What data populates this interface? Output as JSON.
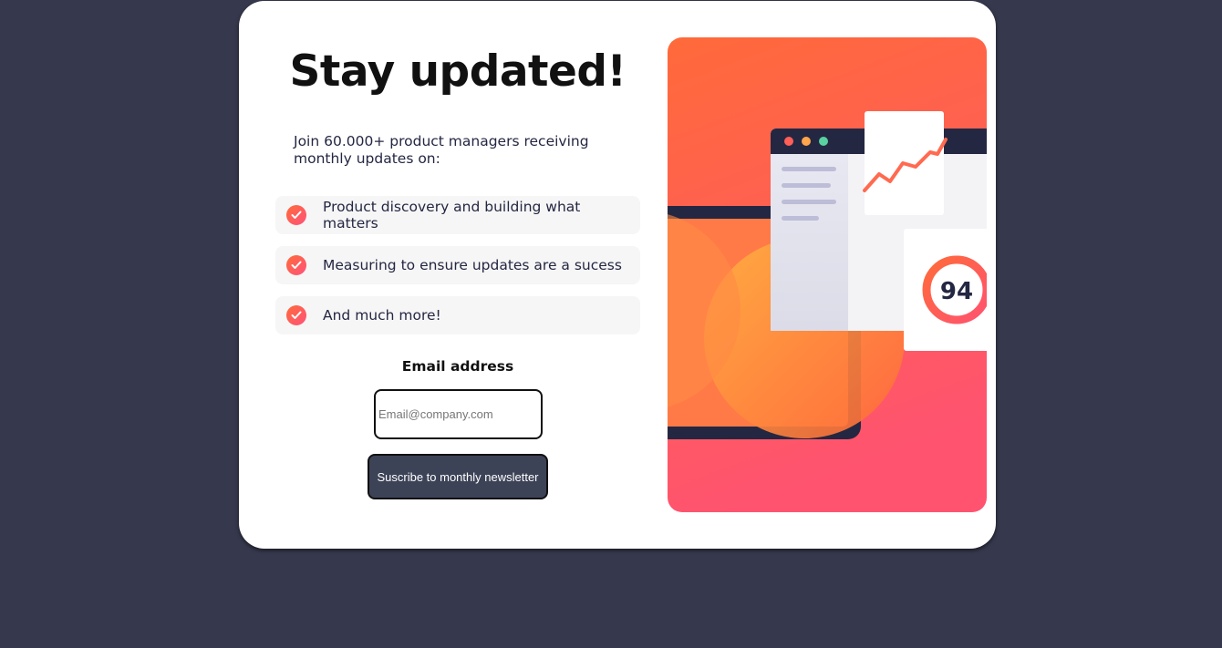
{
  "card": {
    "title": "Stay updated!",
    "intro": "Join 60.000+ product managers receiving monthly updates on:",
    "features": [
      {
        "label": "Product discovery and building what matters",
        "icon": "check-icon"
      },
      {
        "label": "Measuring to ensure updates are a sucess",
        "icon": "check-icon"
      },
      {
        "label": "And much more!",
        "icon": "check-icon"
      }
    ],
    "form": {
      "email_label": "Email address",
      "email_placeholder": "Email@company.com",
      "email_value": "",
      "submit_label": "Suscribe to monthly newsletter"
    },
    "illustration": {
      "score": "94"
    }
  },
  "colors": {
    "background": "#36384d",
    "card": "#ffffff",
    "accent": "#ff6257",
    "button": "#3d4357",
    "text": "#242742"
  }
}
